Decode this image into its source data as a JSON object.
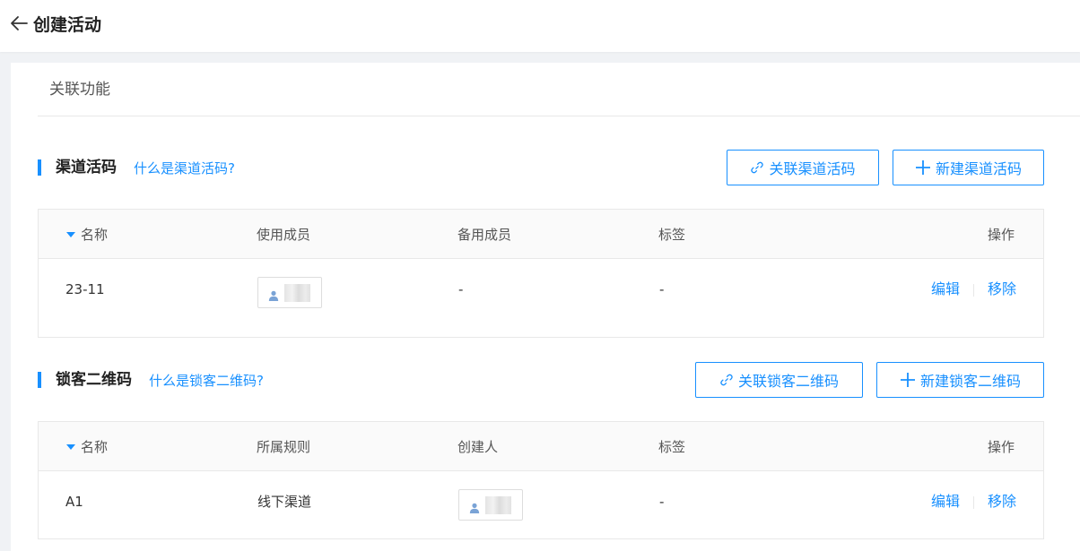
{
  "header": {
    "title": "创建活动"
  },
  "card": {
    "title": "关联功能"
  },
  "channel_section": {
    "title": "渠道活码",
    "help_link": "什么是渠道活码?",
    "link_button": "关联渠道活码",
    "new_button": "新建渠道活码",
    "columns": [
      "名称",
      "使用成员",
      "备用成员",
      "标签",
      "操作"
    ],
    "rows": [
      {
        "name": "23-11",
        "backup_member": "-",
        "tag": "-",
        "edit": "编辑",
        "remove": "移除"
      }
    ]
  },
  "lock_section": {
    "title": "锁客二维码",
    "help_link": "什么是锁客二维码?",
    "link_button": "关联锁客二维码",
    "new_button": "新建锁客二维码",
    "columns": [
      "名称",
      "所属规则",
      "创建人",
      "标签",
      "操作"
    ],
    "rows": [
      {
        "name": "A1",
        "rule": "线下渠道",
        "tag": "-",
        "edit": "编辑",
        "remove": "移除"
      }
    ]
  },
  "colors": {
    "accent": "#1890ff",
    "background": "#f0f2f5",
    "table_header": "#fafafa"
  },
  "icons": [
    "arrow-left-icon",
    "link-icon",
    "plus-icon",
    "user-icon",
    "sort-caret-icon"
  ]
}
